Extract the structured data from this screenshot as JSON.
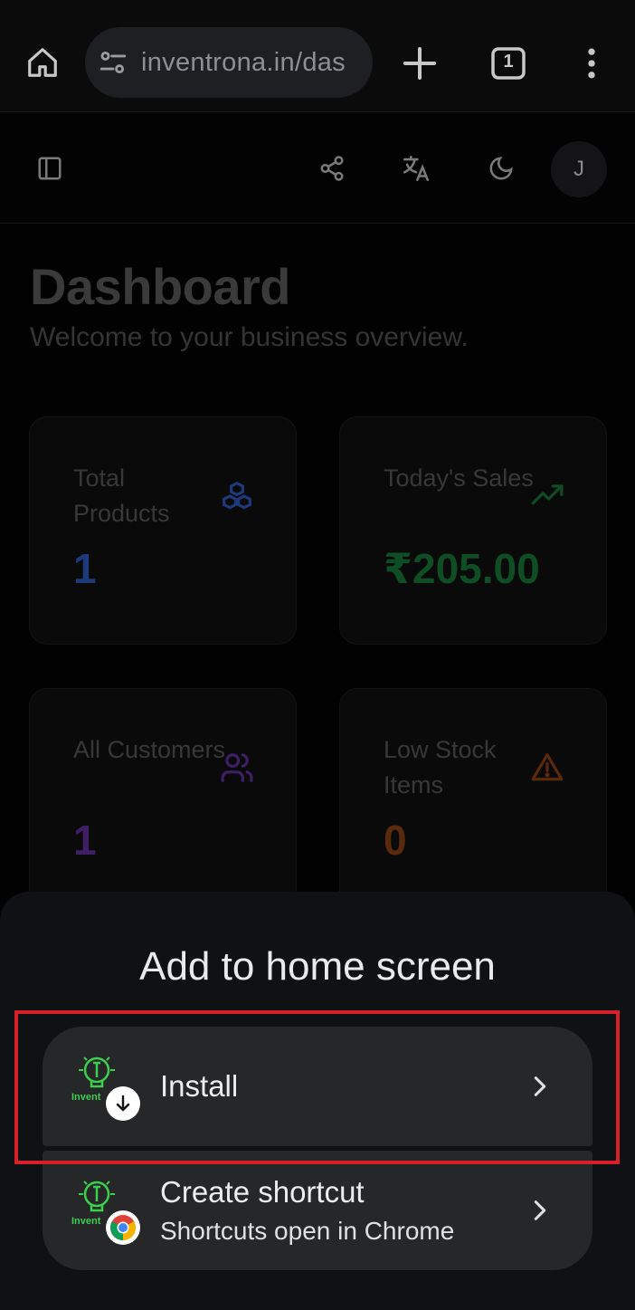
{
  "browser": {
    "url": "inventrona.in/das",
    "tab_count": "1"
  },
  "header": {
    "avatar_initial": "J"
  },
  "page": {
    "title": "Dashboard",
    "subtitle": "Welcome to your business overview."
  },
  "cards": [
    {
      "label": "Total Products",
      "value": "1",
      "icon": "cubes-icon",
      "color": "#1d3a7a"
    },
    {
      "label": "Today's Sales",
      "value": "₹205.00",
      "icon": "trending-up-icon",
      "color": "#0f4d24"
    },
    {
      "label": "All Customers",
      "value": "1",
      "icon": "users-icon",
      "color": "#3e1f66"
    },
    {
      "label": "Low Stock Items",
      "value": "0",
      "icon": "warning-icon",
      "color": "#5b2a0d"
    }
  ],
  "sheet": {
    "title": "Add to home screen",
    "install_label": "Install",
    "shortcut_label": "Create shortcut",
    "shortcut_sub": "Shortcuts open in Chrome",
    "logo_text": "Invent"
  },
  "colors": {
    "highlight": "#d8202a",
    "sheet_bg": "#0f1114",
    "option_bg": "#262729",
    "logo_green": "#3ccf4e"
  }
}
